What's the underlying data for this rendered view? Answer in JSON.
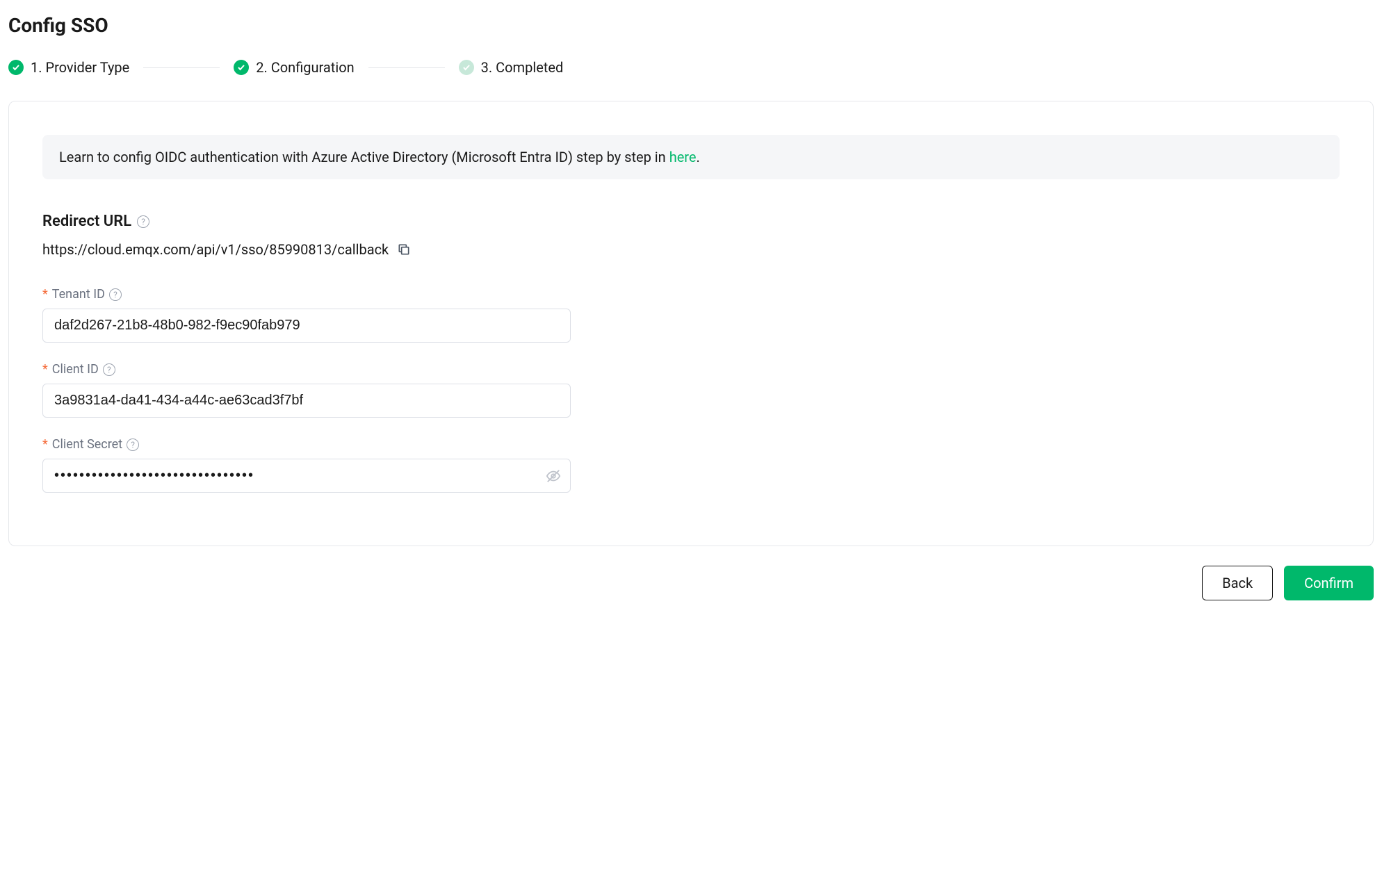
{
  "page": {
    "title": "Config SSO"
  },
  "stepper": {
    "steps": [
      {
        "label": "1. Provider Type",
        "status": "completed"
      },
      {
        "label": "2. Configuration",
        "status": "completed"
      },
      {
        "label": "3. Completed",
        "status": "inactive"
      }
    ]
  },
  "banner": {
    "text_prefix": "Learn to config OIDC authentication with Azure Active Directory (Microsoft Entra ID) step by step in ",
    "link_text": "here",
    "text_suffix": "."
  },
  "redirect": {
    "label": "Redirect URL",
    "value": "https://cloud.emqx.com/api/v1/sso/85990813/callback"
  },
  "form": {
    "tenant_id": {
      "label": "Tenant ID",
      "value": "daf2d267-21b8-48b0-982-f9ec90fab979"
    },
    "client_id": {
      "label": "Client ID",
      "value": "3a9831a4-da41-434-a44c-ae63cad3f7bf"
    },
    "client_secret": {
      "label": "Client Secret",
      "value": "••••••••••••••••••••••••••••••••"
    }
  },
  "actions": {
    "back": "Back",
    "confirm": "Confirm"
  }
}
